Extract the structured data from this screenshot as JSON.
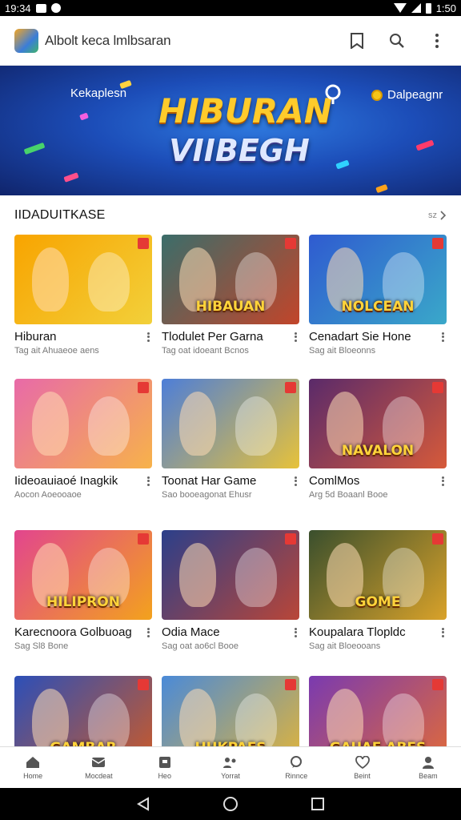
{
  "status_bar": {
    "time": "19:34",
    "clock_right": "1:50"
  },
  "app_bar": {
    "title": "Albolt keca lmlbsaran"
  },
  "banner": {
    "left_text": "Kekaplesn",
    "title": "HIBURAN",
    "subtitle": "VIIBEGH",
    "right_text": "Dalpeagnr"
  },
  "section": {
    "title": "IIDADUITKASE",
    "more_label": "sz"
  },
  "cards": [
    {
      "title": "Hiburan",
      "subtitle": "Tag ait Ahuaeoe aens",
      "caption": "",
      "colors": [
        "#f8a400",
        "#f2d03a"
      ]
    },
    {
      "title": "Tlodulet Per Garna",
      "subtitle": "Tag oat idoeant Bcnos",
      "caption": "HIBAUAN",
      "colors": [
        "#3b6d6a",
        "#c2452a"
      ]
    },
    {
      "title": "Cenadart Sie Hone",
      "subtitle": "Sag ait Bloeonns",
      "caption": "NOLCEAN",
      "colors": [
        "#2f5bd0",
        "#3aa8c9"
      ]
    },
    {
      "title": "Iideoauiaoé Inagkik",
      "subtitle": "Aocon Aoeooaoe",
      "caption": "",
      "colors": [
        "#e86aa8",
        "#f7b24a"
      ]
    },
    {
      "title": "Toonat Har Game",
      "subtitle": "Sao booeagonat Ehusr",
      "caption": "",
      "colors": [
        "#4d7ed8",
        "#e7c23a"
      ]
    },
    {
      "title": "ComlMos",
      "subtitle": "Arg 5d Boaanl Booe",
      "caption": "NAVALON",
      "colors": [
        "#5a2a6a",
        "#d65a3a"
      ]
    },
    {
      "title": "Karecnoora Golbuoag",
      "subtitle": "Sag Sl8 Bone",
      "caption": "HILIPRON",
      "colors": [
        "#e2458e",
        "#f3a21d"
      ]
    },
    {
      "title": "Odia Mace",
      "subtitle": "Sag oat ao6cl Booe",
      "caption": "",
      "colors": [
        "#2b3f8a",
        "#b94638"
      ]
    },
    {
      "title": "Koupalara Tlopldc",
      "subtitle": "Sag ait Bloeooans",
      "caption": "GOME",
      "colors": [
        "#3a4f2d",
        "#d9a22a"
      ]
    },
    {
      "title": "",
      "subtitle": "",
      "caption": "GAMBAR",
      "colors": [
        "#2c4fb8",
        "#c95a2a"
      ]
    },
    {
      "title": "",
      "subtitle": "",
      "caption": "HUKPAES",
      "colors": [
        "#4a8ad8",
        "#e1b43a"
      ]
    },
    {
      "title": "",
      "subtitle": "",
      "caption": "GAUAE ABES",
      "colors": [
        "#7a3ab0",
        "#e06a3a"
      ]
    }
  ],
  "bottom_nav": [
    {
      "label": "Home",
      "icon": "home-icon"
    },
    {
      "label": "Mocdeat",
      "icon": "message-icon"
    },
    {
      "label": "Heo",
      "icon": "library-icon"
    },
    {
      "label": "Yorrat",
      "icon": "people-icon"
    },
    {
      "label": "Rinnce",
      "icon": "chat-icon"
    },
    {
      "label": "Beint",
      "icon": "heart-icon"
    },
    {
      "label": "Beam",
      "icon": "profile-icon"
    }
  ],
  "colors": {
    "accent": "#1c4db8",
    "banner_title": "#ffcb2b"
  }
}
